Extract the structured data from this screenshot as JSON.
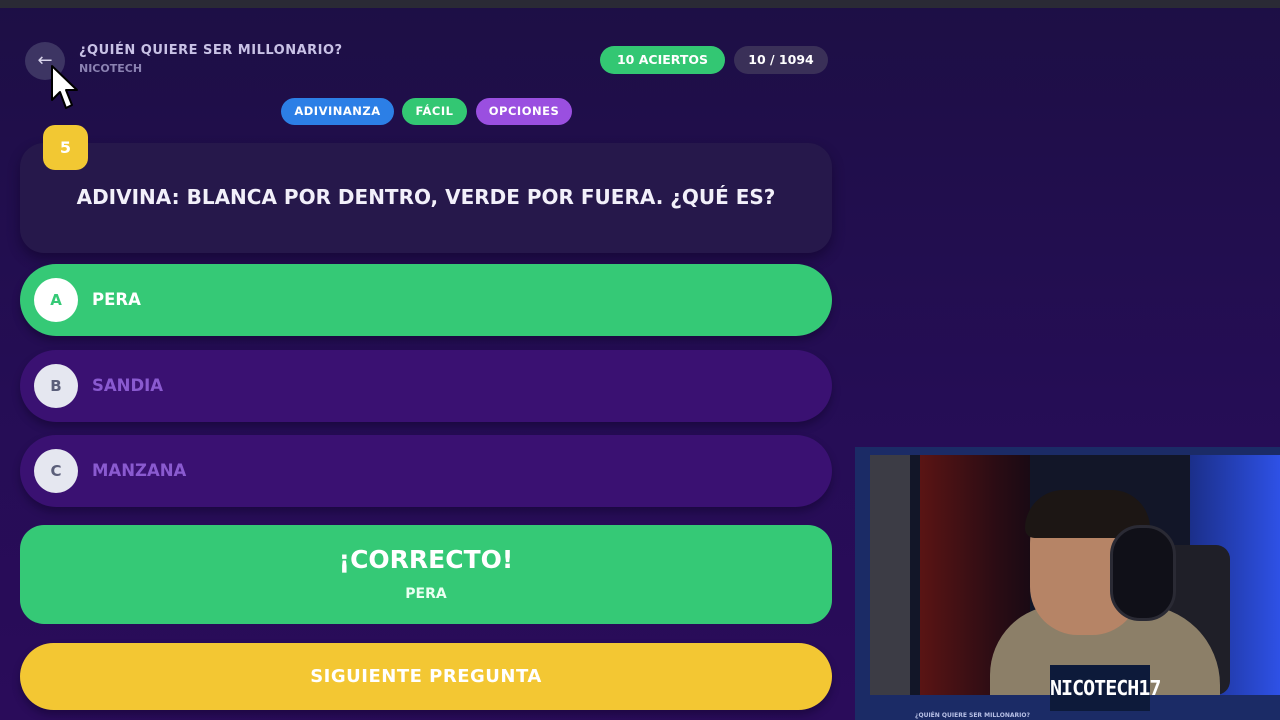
{
  "header": {
    "back_icon": "arrow-left-icon",
    "title": "¿QUIÉN QUIERE SER MILLONARIO?",
    "subtitle": "NICOTECH",
    "score_label": "10 ACIERTOS",
    "progress_label": "10 / 1094"
  },
  "tags": {
    "category": "ADIVINANZA",
    "difficulty": "FÁCIL",
    "mode": "OPCIONES"
  },
  "question": {
    "number": "5",
    "text": "ADIVINA: BLANCA POR DENTRO, VERDE POR FUERA. ¿QUÉ ES?"
  },
  "options": [
    {
      "letter": "A",
      "label": "PERA",
      "state": "correct"
    },
    {
      "letter": "B",
      "label": "SANDIA",
      "state": "disabled"
    },
    {
      "letter": "C",
      "label": "MANZANA",
      "state": "disabled"
    }
  ],
  "result": {
    "title": "¡CORRECTO!",
    "answer": "PERA"
  },
  "next_button": "SIGUIENTE PREGUNTA",
  "webcam": {
    "name": "NICOTECH17",
    "caption": "¿QUIÉN QUIERE SER MILLONARIO?"
  },
  "colors": {
    "green": "#35c976",
    "yellow": "#f3c733",
    "blue": "#2c7fe6",
    "purple": "#9a4fe0",
    "background": "#250d55"
  }
}
